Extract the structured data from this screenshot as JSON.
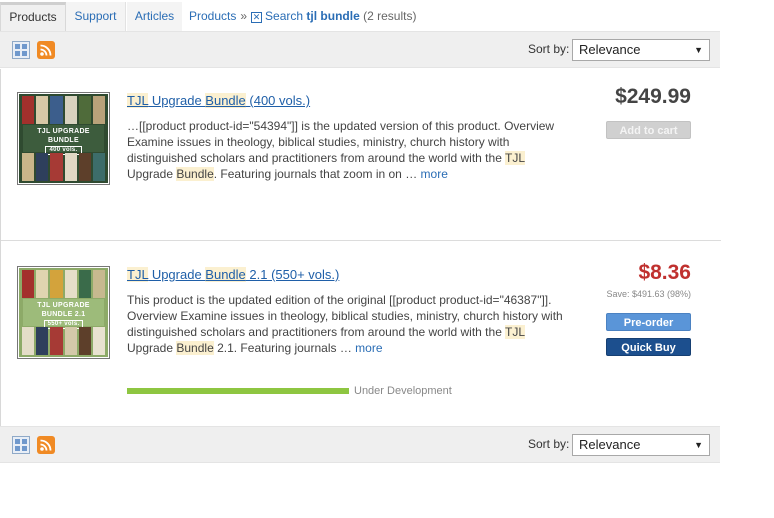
{
  "nav": {
    "tabs": [
      {
        "label": "Products"
      },
      {
        "label": "Support"
      },
      {
        "label": "Articles"
      }
    ],
    "breadcrumb": {
      "products_link": "Products",
      "separator": "»",
      "search_prefix": "Search",
      "search_term": "tjl bundle",
      "result_count": "(2 results)"
    }
  },
  "toolbar": {
    "sort_label": "Sort by:",
    "sort_value": "Relevance",
    "view_icon": "grid-view-icon",
    "feed_icon": "rss-icon"
  },
  "results": [
    {
      "title_parts": [
        "TJL",
        " Upgrade ",
        "Bundle",
        " (400 vols.)"
      ],
      "description_parts": [
        "…[[product product-id=\"54394\"]] is the updated version of this product. Overview Examine issues in theology, biblical studies, ministry, church history with distinguished scholars and practitioners from around the world with the ",
        "TJL",
        " Upgrade ",
        "Bundle",
        ". Featuring journals that zoom in on … "
      ],
      "more": "more",
      "price": "$249.99",
      "button": "Add to cart",
      "thumb": {
        "line1": "TJL UPGRADE",
        "line2": "BUNDLE",
        "badge": "400 vols."
      }
    },
    {
      "title_parts": [
        "TJL",
        " Upgrade ",
        "Bundle",
        " 2.1 (550+ vols.)"
      ],
      "description_parts": [
        "This product is the updated edition of the original [[product product-id=\"46387\"]]. Overview Examine issues in theology, biblical studies, ministry, church history with distinguished scholars and practitioners from around the world with the ",
        "TJL",
        " Upgrade ",
        "Bundle",
        " 2.1. Featuring journals … "
      ],
      "more": "more",
      "price": "$8.36",
      "save": "Save: $491.63 (98%)",
      "buttons": {
        "preorder": "Pre-order",
        "quick_buy": "Quick Buy"
      },
      "thumb": {
        "line1": "TJL UPGRADE",
        "line2": "BUNDLE 2.1",
        "badge": "550+ vols."
      },
      "progress": {
        "value": 1.0,
        "label": "Under Development"
      }
    }
  ],
  "colors": {
    "link": "#2a6db5",
    "sale_price": "#c0312f",
    "preorder": "#5a95d8",
    "quick_buy": "#1c4f8e",
    "progress": "#8ec641"
  }
}
